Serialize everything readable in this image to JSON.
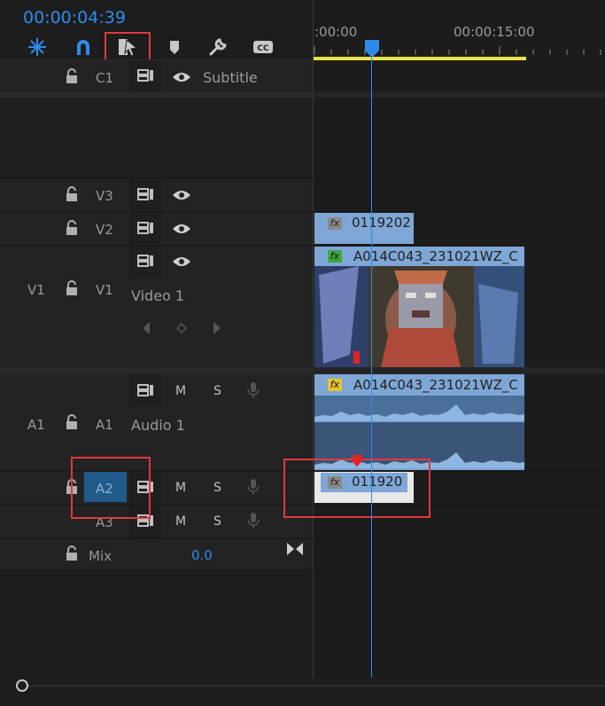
{
  "timecode": "00:00:04:39",
  "ruler": {
    "t0": ":00:00",
    "t15": "00:00:15:00"
  },
  "tracks": {
    "c1": {
      "name": "C1",
      "label": "Subtitle"
    },
    "v3": {
      "name": "V3"
    },
    "v2": {
      "name": "V2"
    },
    "v1": {
      "source": "V1",
      "name": "V1",
      "label": "Video 1"
    },
    "a1": {
      "source": "A1",
      "name": "A1",
      "label": "Audio 1",
      "m": "M",
      "s": "S"
    },
    "a2": {
      "name": "A2",
      "m": "M",
      "s": "S"
    },
    "a3": {
      "name": "A3",
      "m": "M",
      "s": "S"
    },
    "mix": {
      "label": "Mix",
      "value": "0.0"
    }
  },
  "clips": {
    "v2_clip": "0119202",
    "v1_clip": "A014C043_231021WZ_C",
    "a1_clip": "A014C043_231021WZ_C",
    "a2_clip": "011920",
    "fx": "fx"
  },
  "colors": {
    "accent": "#2d8ceb",
    "clip": "#7ea7d6",
    "highlight": "#e0393e",
    "workarea": "#e6e14a"
  }
}
